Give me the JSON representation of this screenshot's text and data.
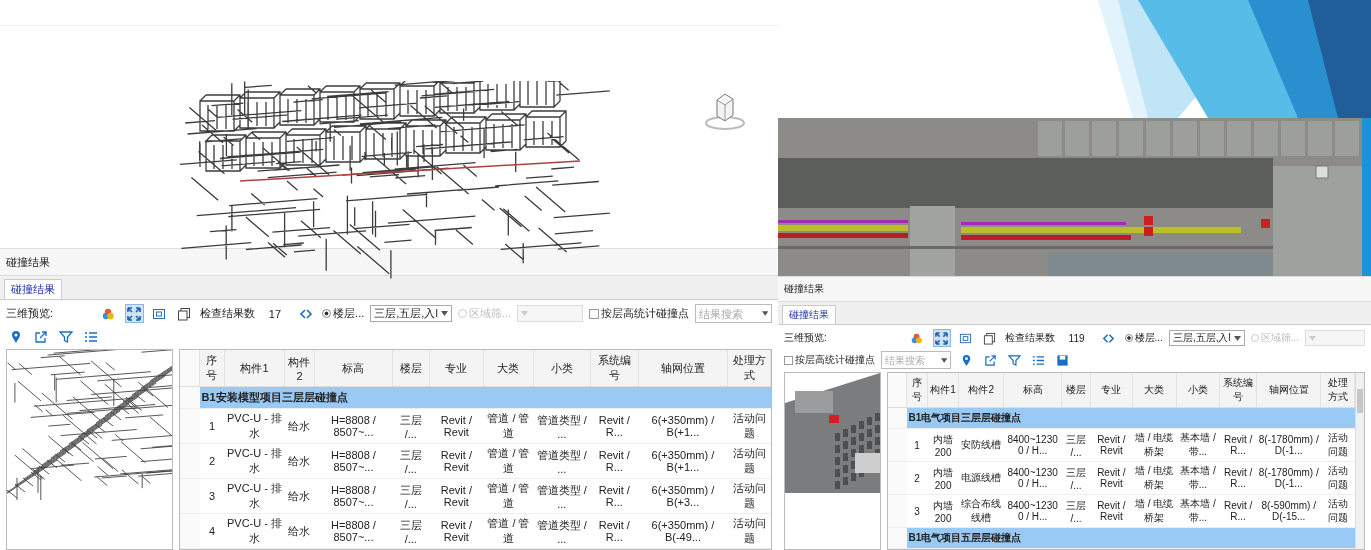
{
  "left_panel": {
    "title": "碰撞结果",
    "tab": {
      "label": "碰撞结果",
      "selected": true
    },
    "preview_label": "三维预览:",
    "view_tools": [
      {
        "kind": "colors",
        "selected": false
      },
      {
        "kind": "fit",
        "selected": true
      },
      {
        "kind": "frame",
        "selected": false
      },
      {
        "kind": "copy",
        "selected": false
      }
    ],
    "count_label": "检查结果数",
    "count": "17",
    "filter_radios": [
      {
        "label": "楼层...",
        "selected": true,
        "disabled": false,
        "value": "三层,五层,入l"
      },
      {
        "label": "区域筛...",
        "selected": false,
        "disabled": true
      }
    ],
    "checkbox": {
      "label": "按层高统计碰撞点",
      "checked": false
    },
    "search": {
      "placeholder": "结果搜索"
    },
    "action_tools": [
      {
        "kind": "pin"
      },
      {
        "kind": "export"
      },
      {
        "kind": "filter"
      },
      {
        "kind": "list"
      }
    ],
    "preview": {
      "kind": "pipes"
    },
    "columns": [
      "序号",
      "构件1",
      "构件2",
      "标高",
      "楼层",
      "专业",
      "大类",
      "小类",
      "系统编号",
      "轴网位置",
      "处理方式"
    ],
    "groups": [
      {
        "title": "B1安装模型项目三层层碰撞点",
        "rows": [
          [
            "1",
            "PVC-U - 排水",
            "给水",
            "H=8808 / 8507~...",
            "三层 /...",
            "Revit / Revit",
            "管道 / 管道",
            "管道类型 / ...",
            "Revit / R...",
            "6(+350mm) / B(+1...",
            "活动问题"
          ],
          [
            "2",
            "PVC-U - 排水",
            "给水",
            "H=8808 / 8507~...",
            "三层 /...",
            "Revit / Revit",
            "管道 / 管道",
            "管道类型 / ...",
            "Revit / R...",
            "6(+350mm) / B(+1...",
            "活动问题"
          ],
          [
            "3",
            "PVC-U - 排水",
            "给水",
            "H=8808 / 8507~...",
            "三层 /...",
            "Revit / Revit",
            "管道 / 管道",
            "管道类型 / ...",
            "Revit / R...",
            "6(+350mm) / B(+3...",
            "活动问题"
          ],
          [
            "4",
            "PVC-U - 排水",
            "给水",
            "H=8808 / 8507~...",
            "三层 /...",
            "Revit / Revit",
            "管道 / 管道",
            "管道类型 / ...",
            "Revit / R...",
            "6(+350mm) / B(-49...",
            "活动问题"
          ]
        ]
      }
    ]
  },
  "right_panel": {
    "title": "碰撞结果",
    "tab": {
      "label": "碰撞结果",
      "selected": true
    },
    "preview_label": "三维预览:",
    "view_tools": [
      {
        "kind": "colors",
        "selected": false
      },
      {
        "kind": "fit",
        "selected": true
      },
      {
        "kind": "frame",
        "selected": false
      },
      {
        "kind": "copy",
        "selected": false
      }
    ],
    "count_label": "检查结果数",
    "count": "119",
    "filter_radios": [
      {
        "label": "楼层...",
        "selected": true,
        "disabled": false,
        "value": "三层,五层,入l"
      },
      {
        "label": "区域筛...",
        "selected": false,
        "disabled": true
      }
    ],
    "checkbox": {
      "label": "按层高统计碰撞点",
      "checked": false
    },
    "search": {
      "placeholder": "结果搜索"
    },
    "action_tools": [
      {
        "kind": "pin"
      },
      {
        "kind": "export"
      },
      {
        "kind": "filter"
      },
      {
        "kind": "list"
      },
      {
        "kind": "save"
      }
    ],
    "preview": {
      "kind": "building"
    },
    "columns": [
      "序号",
      "构件1",
      "构件2",
      "标高",
      "楼层",
      "专业",
      "大类",
      "小类",
      "系统编号",
      "轴网位置",
      "处理方式"
    ],
    "groups": [
      {
        "title": "B1电气项目三层层碰撞点",
        "rows": [
          [
            "1",
            "内墙200",
            "安防线槽",
            "8400~12300 / H...",
            "三层 /...",
            "Revit / Revit",
            "墙 / 电缆桥架",
            "基本墙 / 带...",
            "Revit / R...",
            "8(-1780mm) / D(-1...",
            "活动问题"
          ],
          [
            "2",
            "内墙200",
            "电源线槽",
            "8400~12300 / H...",
            "三层 /...",
            "Revit / Revit",
            "墙 / 电缆桥架",
            "基本墙 / 带...",
            "Revit / R...",
            "8(-1780mm) / D(-1...",
            "活动问题"
          ],
          [
            "3",
            "内墙200",
            "综合布线线槽",
            "8400~12300 / H...",
            "三层 /...",
            "Revit / Revit",
            "墙 / 电缆桥架",
            "基本墙 / 带...",
            "Revit / R...",
            "8(-590mm) / D(-15...",
            "活动问题"
          ]
        ]
      },
      {
        "title": "B1电气项目五层层碰撞点"
      }
    ]
  }
}
